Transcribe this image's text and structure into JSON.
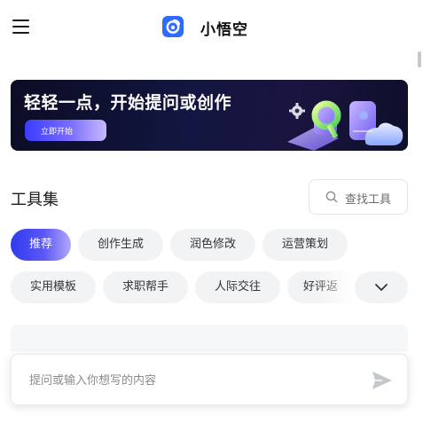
{
  "header": {
    "app_title": "小悟空",
    "menu_icon": "hamburger-menu-icon",
    "logo_icon": "app-logo-icon",
    "brand_color": "#2f6bff"
  },
  "banner": {
    "title": "轻轻一点，开始提问或创作",
    "button_label": "立即开始",
    "art_icon": "gear-and-3d-shapes-illustration"
  },
  "tools": {
    "section_title": "工具集",
    "search_label": "查找工具",
    "search_icon": "search-icon",
    "categories": [
      {
        "label": "推荐",
        "active": true
      },
      {
        "label": "创作生成",
        "active": false
      },
      {
        "label": "润色修改",
        "active": false
      },
      {
        "label": "运营策划",
        "active": false
      },
      {
        "label": "实用模板",
        "active": false
      },
      {
        "label": "求职帮手",
        "active": false
      },
      {
        "label": "人际交往",
        "active": false
      },
      {
        "label": "好评返",
        "active": false
      }
    ],
    "expand_icon": "chevron-down-icon",
    "active_color": "#2f3bf0"
  },
  "input": {
    "placeholder": "提问或输入你想写的内容",
    "value": "",
    "send_icon": "send-icon"
  }
}
